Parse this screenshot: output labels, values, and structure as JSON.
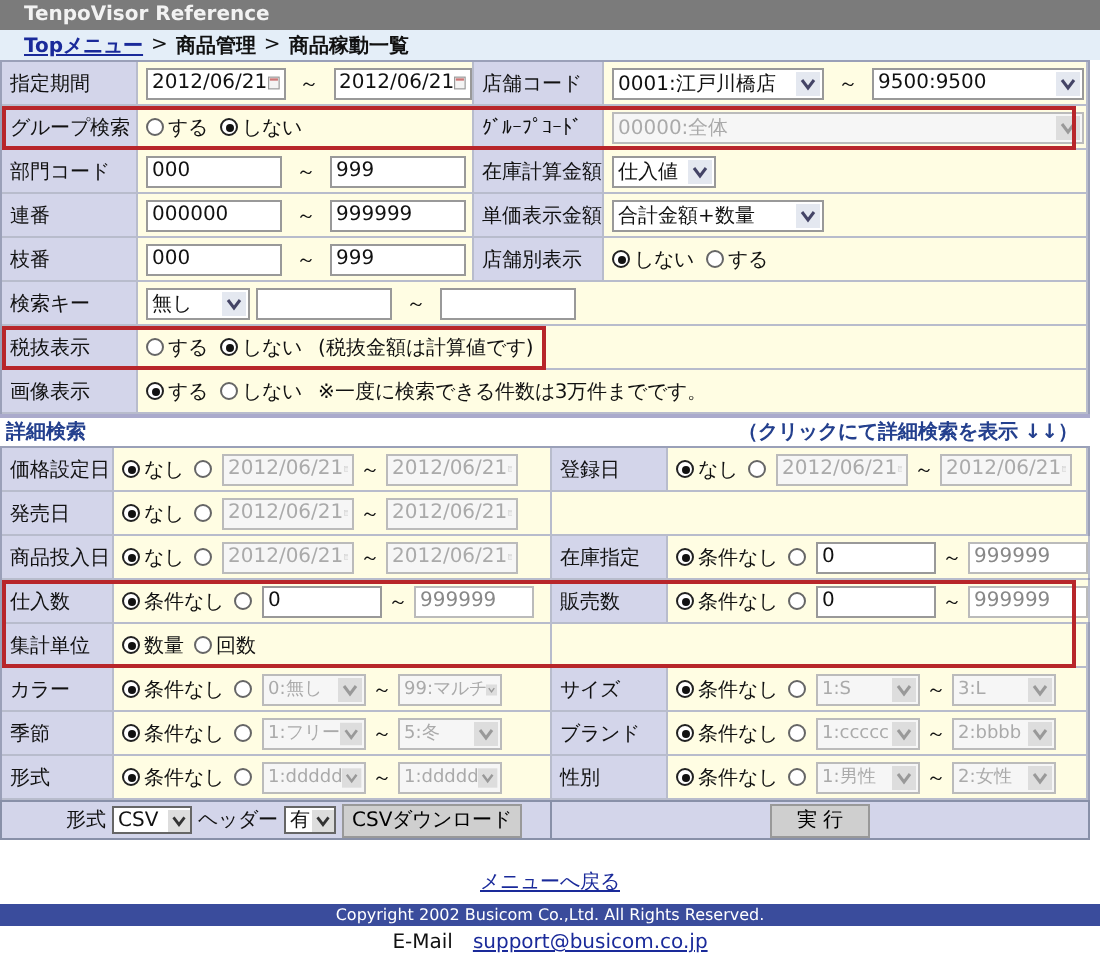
{
  "window": {
    "title": "TenpoVisor Reference"
  },
  "breadcrumb": {
    "separator": ">",
    "items": [
      {
        "text": "Topメニュー",
        "link": true
      },
      {
        "text": "商品管理",
        "link": false
      },
      {
        "text": "商品稼動一覧",
        "link": false
      }
    ]
  },
  "main": [
    {
      "label": "指定期間",
      "highlight": false,
      "cells": [
        {
          "kind": "date",
          "value": "2012/06/21",
          "disabled": false
        },
        {
          "kind": "tilde",
          "text": "～"
        },
        {
          "kind": "date",
          "value": "2012/06/21",
          "disabled": false
        }
      ],
      "label2": "店舗コード",
      "cells2": [
        {
          "kind": "select",
          "value": "0001:江戸川橋店",
          "disabled": false
        },
        {
          "kind": "tilde",
          "text": "～"
        },
        {
          "kind": "select",
          "value": "9500:9500",
          "disabled": false
        }
      ]
    },
    {
      "label": "グループ検索",
      "highlight": true,
      "cells": [
        {
          "kind": "radio",
          "label": "する",
          "selected": false
        },
        {
          "kind": "radio",
          "label": "しない",
          "selected": true
        }
      ],
      "label2": "ｸﾞﾙｰﾌﾟｺｰﾄﾞ",
      "cells2": [
        {
          "kind": "select",
          "value": "00000:全体",
          "disabled": true
        }
      ]
    },
    {
      "label": "部門コード",
      "highlight": false,
      "cells": [
        {
          "kind": "text",
          "value": "000",
          "disabled": false
        },
        {
          "kind": "tilde",
          "text": "～"
        },
        {
          "kind": "text",
          "value": "999",
          "disabled": false
        }
      ],
      "label2": "在庫計算金額",
      "cells2": [
        {
          "kind": "select",
          "value": "仕入値",
          "disabled": false
        }
      ]
    },
    {
      "label": "連番",
      "highlight": false,
      "cells": [
        {
          "kind": "text",
          "value": "000000",
          "disabled": false
        },
        {
          "kind": "tilde",
          "text": "～"
        },
        {
          "kind": "text",
          "value": "999999",
          "disabled": false
        }
      ],
      "label2": "単価表示金額",
      "cells2": [
        {
          "kind": "select",
          "value": "合計金額+数量",
          "disabled": false
        }
      ]
    },
    {
      "label": "枝番",
      "highlight": false,
      "cells": [
        {
          "kind": "text",
          "value": "000",
          "disabled": false
        },
        {
          "kind": "tilde",
          "text": "～"
        },
        {
          "kind": "text",
          "value": "999",
          "disabled": false
        }
      ],
      "label2": "店舗別表示",
      "cells2": [
        {
          "kind": "radio",
          "label": "しない",
          "selected": true
        },
        {
          "kind": "radio",
          "label": "する",
          "selected": false
        }
      ]
    },
    {
      "label": "検索キー",
      "highlight": false,
      "cells": [
        {
          "kind": "select",
          "value": "無し",
          "disabled": false
        },
        {
          "kind": "text",
          "disabled": false
        },
        {
          "kind": "tilde",
          "text": "～"
        },
        {
          "kind": "text",
          "disabled": false
        }
      ]
    },
    {
      "label": "税抜表示",
      "highlight": true,
      "cells": [
        {
          "kind": "radio",
          "label": "する",
          "selected": false
        },
        {
          "kind": "radio",
          "label": "しない",
          "selected": true
        },
        {
          "kind": "note",
          "text": "(税抜金額は計算値です)"
        }
      ]
    },
    {
      "label": "画像表示",
      "highlight": false,
      "cells": [
        {
          "kind": "radio",
          "label": "する",
          "selected": true
        },
        {
          "kind": "radio",
          "label": "しない",
          "selected": false
        },
        {
          "kind": "note",
          "text": "※一度に検索できる件数は3万件までです。"
        }
      ]
    }
  ],
  "detail_section": {
    "title": "詳細検索",
    "toggle_link": "（クリックにて詳細検索を表示 ↓↓）"
  },
  "detail": [
    {
      "label": "価格設定日",
      "highlight": false,
      "cells": [
        {
          "kind": "radio",
          "label": "なし",
          "selected": true
        },
        {
          "kind": "radio",
          "selected": false
        },
        {
          "kind": "date",
          "value": "2012/06/21",
          "disabled": true
        },
        {
          "kind": "tilde",
          "text": "～"
        },
        {
          "kind": "date",
          "value": "2012/06/21",
          "disabled": true
        }
      ],
      "label2": "登録日",
      "cells2": [
        {
          "kind": "radio",
          "label": "なし",
          "selected": true
        },
        {
          "kind": "radio",
          "selected": false
        },
        {
          "kind": "date",
          "value": "2012/06/21",
          "disabled": true
        },
        {
          "kind": "tilde",
          "text": "～"
        },
        {
          "kind": "date",
          "value": "2012/06/21",
          "disabled": true
        }
      ]
    },
    {
      "label": "発売日",
      "highlight": false,
      "cells": [
        {
          "kind": "radio",
          "label": "なし",
          "selected": true
        },
        {
          "kind": "radio",
          "selected": false
        },
        {
          "kind": "date",
          "value": "2012/06/21",
          "disabled": true
        },
        {
          "kind": "tilde",
          "text": "～"
        },
        {
          "kind": "date",
          "value": "2012/06/21",
          "disabled": true
        }
      ]
    },
    {
      "label": "商品投入日",
      "highlight": false,
      "cells": [
        {
          "kind": "radio",
          "label": "なし",
          "selected": true
        },
        {
          "kind": "radio",
          "selected": false
        },
        {
          "kind": "date",
          "value": "2012/06/21",
          "disabled": true
        },
        {
          "kind": "tilde",
          "text": "～"
        },
        {
          "kind": "date",
          "value": "2012/06/21",
          "disabled": true
        }
      ],
      "label2": "在庫指定",
      "cells2": [
        {
          "kind": "radio",
          "label": "条件なし",
          "selected": true
        },
        {
          "kind": "radio",
          "selected": false
        },
        {
          "kind": "text",
          "value": "0",
          "disabled": false
        },
        {
          "kind": "tilde",
          "text": "～"
        },
        {
          "kind": "text",
          "value": "999999",
          "disabled": true
        }
      ]
    },
    {
      "label": "仕入数",
      "highlight": true,
      "cells": [
        {
          "kind": "radio",
          "label": "条件なし",
          "selected": true
        },
        {
          "kind": "radio",
          "selected": false
        },
        {
          "kind": "text",
          "value": "0",
          "disabled": false
        },
        {
          "kind": "tilde",
          "text": "～"
        },
        {
          "kind": "text",
          "value": "999999",
          "disabled": true
        }
      ],
      "label2": "販売数",
      "cells2": [
        {
          "kind": "radio",
          "label": "条件なし",
          "selected": true
        },
        {
          "kind": "radio",
          "selected": false
        },
        {
          "kind": "text",
          "value": "0",
          "disabled": false
        },
        {
          "kind": "tilde",
          "text": "～"
        },
        {
          "kind": "text",
          "value": "999999",
          "disabled": true
        }
      ]
    },
    {
      "label": "集計単位",
      "highlight": true,
      "cells": [
        {
          "kind": "radio",
          "label": "数量",
          "selected": true
        },
        {
          "kind": "radio",
          "label": "回数",
          "selected": false
        }
      ]
    },
    {
      "label": "カラー",
      "highlight": false,
      "cells": [
        {
          "kind": "radio",
          "label": "条件なし",
          "selected": true
        },
        {
          "kind": "radio",
          "selected": false
        },
        {
          "kind": "select",
          "value": "0:無し",
          "disabled": true
        },
        {
          "kind": "tilde",
          "text": "～"
        },
        {
          "kind": "select",
          "value": "99:マルチ",
          "disabled": true
        }
      ],
      "label2": "サイズ",
      "cells2": [
        {
          "kind": "radio",
          "label": "条件なし",
          "selected": true
        },
        {
          "kind": "radio",
          "selected": false
        },
        {
          "kind": "select",
          "value": "1:S",
          "disabled": true
        },
        {
          "kind": "tilde",
          "text": "～"
        },
        {
          "kind": "select",
          "value": "3:L",
          "disabled": true
        }
      ]
    },
    {
      "label": "季節",
      "highlight": false,
      "cells": [
        {
          "kind": "radio",
          "label": "条件なし",
          "selected": true
        },
        {
          "kind": "radio",
          "selected": false
        },
        {
          "kind": "select",
          "value": "1:フリー",
          "disabled": true
        },
        {
          "kind": "tilde",
          "text": "～"
        },
        {
          "kind": "select",
          "value": "5:冬",
          "disabled": true
        }
      ],
      "label2": "ブランド",
      "cells2": [
        {
          "kind": "radio",
          "label": "条件なし",
          "selected": true
        },
        {
          "kind": "radio",
          "selected": false
        },
        {
          "kind": "select",
          "value": "1:ccccc",
          "disabled": true
        },
        {
          "kind": "tilde",
          "text": "～"
        },
        {
          "kind": "select",
          "value": "2:bbbb",
          "disabled": true
        }
      ]
    },
    {
      "label": "形式",
      "highlight": false,
      "cells": [
        {
          "kind": "radio",
          "label": "条件なし",
          "selected": true
        },
        {
          "kind": "radio",
          "selected": false
        },
        {
          "kind": "select",
          "value": "1:ddddd",
          "disabled": true
        },
        {
          "kind": "tilde",
          "text": "～"
        },
        {
          "kind": "select",
          "value": "1:ddddd",
          "disabled": true
        }
      ],
      "label2": "性別",
      "cells2": [
        {
          "kind": "radio",
          "label": "条件なし",
          "selected": true
        },
        {
          "kind": "radio",
          "selected": false
        },
        {
          "kind": "select",
          "value": "1:男性",
          "disabled": true
        },
        {
          "kind": "tilde",
          "text": "～"
        },
        {
          "kind": "select",
          "value": "2:女性",
          "disabled": true
        }
      ]
    }
  ],
  "actions": {
    "format_label": "形式",
    "format": "CSV",
    "header_label": "ヘッダー",
    "header": "有",
    "download_button": "CSVダウンロード",
    "run_button": "実 行"
  },
  "footer": {
    "back_link": "メニューへ戻る",
    "copyright": "Copyright 2002 Busicom Co.,Ltd. All Rights Reserved.",
    "email_label": "E-Mail",
    "email": "support@busicom.co.jp"
  }
}
